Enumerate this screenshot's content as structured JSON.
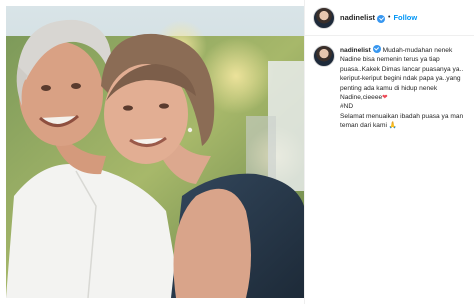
{
  "post": {
    "username": "nadinelist",
    "follow_label": "Follow",
    "separator": "•",
    "caption_text": " Mudah-mudahan nenek Nadine bisa nemenin terus ya tiap puasa..Kakek Dimas lancar puasanya ya.. keriput-keriput begini ndak papa ya..yang penting ada kamu di hidup nenek Nadine,cieeee",
    "caption_heart": "❤",
    "caption_hashtag": "#ND",
    "caption_closing": "Selamat menuaikan ibadah puasa ya man teman dari kami 🙏"
  },
  "icons": {
    "avatar": "profile-avatar",
    "verified": "verified-badge-icon",
    "photo": "couple-photo"
  },
  "colors": {
    "follow": "#0095f6",
    "verified": "#3897f0",
    "heart": "#ed4956",
    "text": "#262626",
    "border": "#efefef"
  }
}
